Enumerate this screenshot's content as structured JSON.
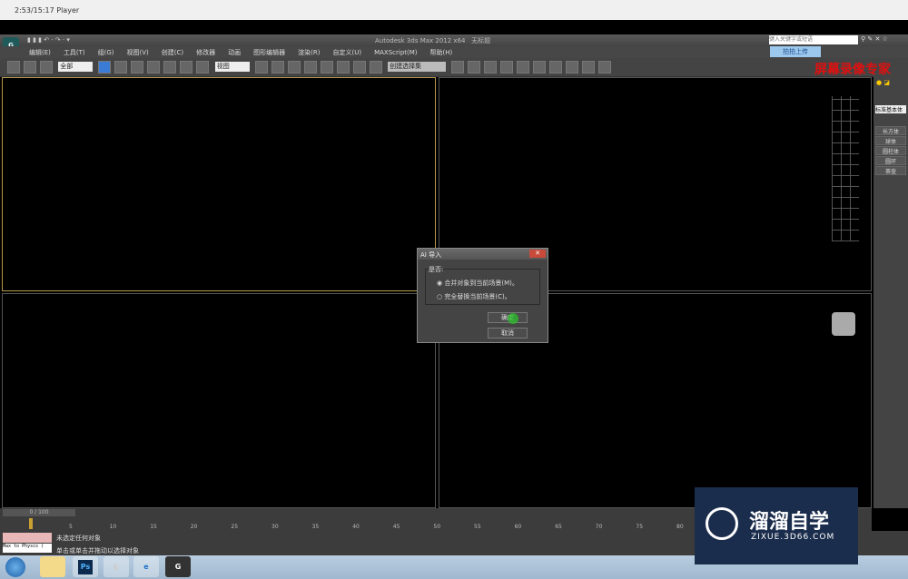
{
  "player": {
    "title": "2:53/15:17 Player"
  },
  "app": {
    "title": "Autodesk 3ds Max  2012 x64",
    "doc": "无标题",
    "search_placeholder": "键入关键字或短语",
    "upload": "拍拍上传",
    "recorder_watermark": "屏幕录像专家"
  },
  "menu": [
    "编辑(E)",
    "工具(T)",
    "组(G)",
    "视图(V)",
    "创建(C)",
    "修改器",
    "动画",
    "图形编辑器",
    "渲染(R)",
    "自定义(U)",
    "MAXScript(M)",
    "帮助(H)"
  ],
  "toolbar": {
    "filter": "全部",
    "coord": "视图",
    "selection_set": "创建选择集"
  },
  "dialog": {
    "title": "AI 导入",
    "group": "是否:",
    "options": [
      "合并对象到当前场景(M)。",
      "完全替换当前场景(C)。"
    ],
    "selected": 0,
    "ok": "确定",
    "cancel": "取消"
  },
  "panel": {
    "category": "标准基本体",
    "buttons": [
      "长方体",
      "球体",
      "圆柱体",
      "圆环",
      "茶壶"
    ]
  },
  "timeline": {
    "frame": "0 / 100",
    "ticks": [
      "5",
      "10",
      "15",
      "20",
      "25",
      "30",
      "35",
      "40",
      "45",
      "50",
      "55",
      "60",
      "65",
      "70",
      "75",
      "80"
    ]
  },
  "status": {
    "script": "Max to Physcs (",
    "line1": "未选定任何对象",
    "line2": "单击或单击并拖动以选择对象"
  },
  "taskbar": [
    "Ps"
  ],
  "watermark": {
    "name": "溜溜自学",
    "url": "ZIXUE.3D66.COM"
  }
}
